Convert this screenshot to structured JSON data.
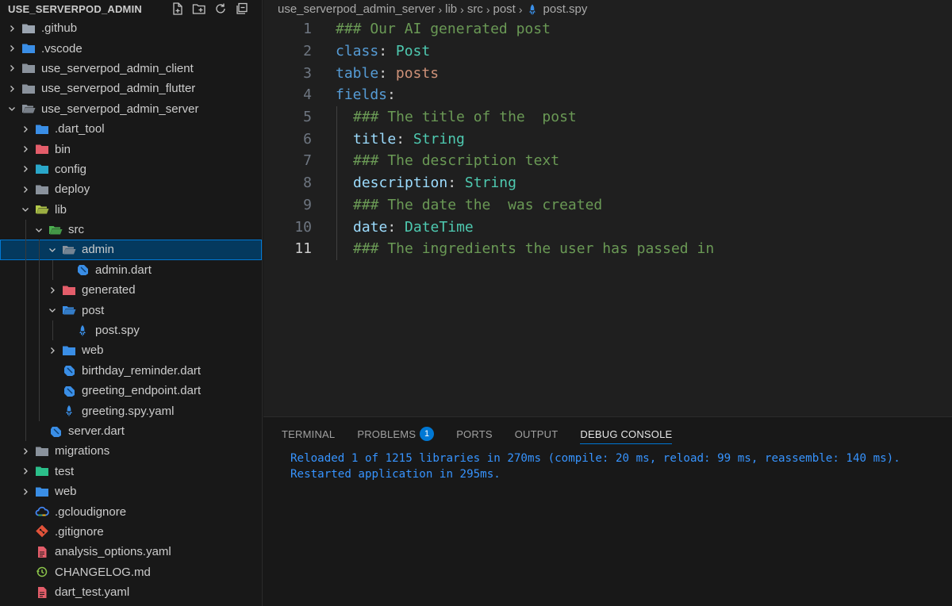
{
  "explorer": {
    "title": "USE_SERVERPOD_ADMIN",
    "actions": [
      "new-file-icon",
      "new-folder-icon",
      "refresh-icon",
      "collapse-all-icon"
    ],
    "tree": [
      {
        "label": ".github",
        "depth": 0,
        "kind": "folder",
        "state": "collapsed",
        "icon": "github-folder-icon",
        "color": "#9aa4b0"
      },
      {
        "label": ".vscode",
        "depth": 0,
        "kind": "folder",
        "state": "collapsed",
        "icon": "vscode-folder-icon",
        "color": "#3a8ee6"
      },
      {
        "label": "use_serverpod_admin_client",
        "depth": 0,
        "kind": "folder",
        "state": "collapsed",
        "icon": "folder-icon",
        "color": "#8a929c"
      },
      {
        "label": "use_serverpod_admin_flutter",
        "depth": 0,
        "kind": "folder",
        "state": "collapsed",
        "icon": "folder-icon",
        "color": "#8a929c"
      },
      {
        "label": "use_serverpod_admin_server",
        "depth": 0,
        "kind": "folder",
        "state": "expanded",
        "icon": "folder-open-icon",
        "color": "#8a929c"
      },
      {
        "label": ".dart_tool",
        "depth": 1,
        "kind": "folder",
        "state": "collapsed",
        "icon": "dart-tool-folder-icon",
        "color": "#3a8ee6"
      },
      {
        "label": "bin",
        "depth": 1,
        "kind": "folder",
        "state": "collapsed",
        "icon": "bin-folder-icon",
        "color": "#e35d6a"
      },
      {
        "label": "config",
        "depth": 1,
        "kind": "folder",
        "state": "collapsed",
        "icon": "config-folder-icon",
        "color": "#2aa7c9"
      },
      {
        "label": "deploy",
        "depth": 1,
        "kind": "folder",
        "state": "collapsed",
        "icon": "folder-icon",
        "color": "#8a929c"
      },
      {
        "label": "lib",
        "depth": 1,
        "kind": "folder",
        "state": "expanded",
        "icon": "lib-folder-icon",
        "color": "#b3c94a"
      },
      {
        "label": "src",
        "depth": 2,
        "kind": "folder",
        "state": "expanded",
        "icon": "src-folder-icon",
        "color": "#4caf50"
      },
      {
        "label": "admin",
        "depth": 3,
        "kind": "folder",
        "state": "expanded",
        "icon": "admin-folder-icon",
        "color": "#8a929c",
        "selected": true
      },
      {
        "label": "admin.dart",
        "depth": 4,
        "kind": "file",
        "icon": "dart-file-icon",
        "color": "#3a8ee6"
      },
      {
        "label": "generated",
        "depth": 3,
        "kind": "folder",
        "state": "collapsed",
        "icon": "generated-folder-icon",
        "color": "#e35d6a"
      },
      {
        "label": "post",
        "depth": 3,
        "kind": "folder",
        "state": "expanded",
        "icon": "post-folder-icon",
        "color": "#3a8ee6"
      },
      {
        "label": "post.spy",
        "depth": 4,
        "kind": "file",
        "icon": "serverpod-file-icon",
        "color": "#3a8ee6"
      },
      {
        "label": "web",
        "depth": 3,
        "kind": "folder",
        "state": "collapsed",
        "icon": "web-folder-icon",
        "color": "#3a8ee6"
      },
      {
        "label": "birthday_reminder.dart",
        "depth": 3,
        "kind": "file",
        "icon": "dart-file-icon",
        "color": "#3a8ee6"
      },
      {
        "label": "greeting_endpoint.dart",
        "depth": 3,
        "kind": "file",
        "icon": "dart-file-icon",
        "color": "#3a8ee6"
      },
      {
        "label": "greeting.spy.yaml",
        "depth": 3,
        "kind": "file",
        "icon": "serverpod-file-icon",
        "color": "#3a8ee6"
      },
      {
        "label": "server.dart",
        "depth": 2,
        "kind": "file",
        "icon": "dart-file-icon",
        "color": "#3a8ee6"
      },
      {
        "label": "migrations",
        "depth": 1,
        "kind": "folder",
        "state": "collapsed",
        "icon": "folder-icon",
        "color": "#8a929c"
      },
      {
        "label": "test",
        "depth": 1,
        "kind": "folder",
        "state": "collapsed",
        "icon": "test-folder-icon",
        "color": "#2bbf8a"
      },
      {
        "label": "web",
        "depth": 1,
        "kind": "folder",
        "state": "collapsed",
        "icon": "web-folder-icon",
        "color": "#3a8ee6"
      },
      {
        "label": ".gcloudignore",
        "depth": 1,
        "kind": "file",
        "icon": "gcloud-icon",
        "color": "#4285f4"
      },
      {
        "label": ".gitignore",
        "depth": 1,
        "kind": "file",
        "icon": "git-icon",
        "color": "#e2533a"
      },
      {
        "label": "analysis_options.yaml",
        "depth": 1,
        "kind": "file",
        "icon": "yaml-file-icon",
        "color": "#e35d6a"
      },
      {
        "label": "CHANGELOG.md",
        "depth": 1,
        "kind": "file",
        "icon": "changelog-icon",
        "color": "#8bc34a"
      },
      {
        "label": "dart_test.yaml",
        "depth": 1,
        "kind": "file",
        "icon": "yaml-file-icon",
        "color": "#e35d6a"
      }
    ]
  },
  "breadcrumb": {
    "items": [
      "use_serverpod_admin_server",
      "lib",
      "src",
      "post"
    ],
    "file": "post.spy",
    "file_icon": "serverpod-file-icon"
  },
  "editor": {
    "active_line": 11,
    "lines": [
      {
        "n": "1",
        "indent": false,
        "tokens": [
          {
            "t": "### Our AI generated post",
            "c": "comment"
          }
        ]
      },
      {
        "n": "2",
        "indent": false,
        "tokens": [
          {
            "t": "class",
            "c": "key-dim"
          },
          {
            "t": ": ",
            "c": "punct"
          },
          {
            "t": "Post",
            "c": "class"
          }
        ]
      },
      {
        "n": "3",
        "indent": false,
        "tokens": [
          {
            "t": "table",
            "c": "key-dim"
          },
          {
            "t": ": ",
            "c": "punct"
          },
          {
            "t": "posts",
            "c": "str"
          }
        ]
      },
      {
        "n": "4",
        "indent": false,
        "tokens": [
          {
            "t": "fields",
            "c": "key-dim"
          },
          {
            "t": ":",
            "c": "punct"
          }
        ]
      },
      {
        "n": "5",
        "indent": true,
        "tokens": [
          {
            "t": "### The title of the  post",
            "c": "comment"
          }
        ]
      },
      {
        "n": "6",
        "indent": true,
        "tokens": [
          {
            "t": "title",
            "c": "key"
          },
          {
            "t": ": ",
            "c": "punct"
          },
          {
            "t": "String",
            "c": "class"
          }
        ]
      },
      {
        "n": "7",
        "indent": true,
        "tokens": [
          {
            "t": "### The description text",
            "c": "comment"
          }
        ]
      },
      {
        "n": "8",
        "indent": true,
        "tokens": [
          {
            "t": "description",
            "c": "key"
          },
          {
            "t": ": ",
            "c": "punct"
          },
          {
            "t": "String",
            "c": "class"
          }
        ]
      },
      {
        "n": "9",
        "indent": true,
        "tokens": [
          {
            "t": "### The date the  was created",
            "c": "comment"
          }
        ]
      },
      {
        "n": "10",
        "indent": true,
        "tokens": [
          {
            "t": "date",
            "c": "key"
          },
          {
            "t": ": ",
            "c": "punct"
          },
          {
            "t": "DateTime",
            "c": "class"
          }
        ]
      },
      {
        "n": "11",
        "indent": true,
        "tokens": [
          {
            "t": "### The ingredients the user has passed in",
            "c": "comment"
          }
        ]
      }
    ]
  },
  "panel": {
    "tabs": [
      {
        "label": "TERMINAL",
        "active": false
      },
      {
        "label": "PROBLEMS",
        "active": false,
        "badge": "1"
      },
      {
        "label": "PORTS",
        "active": false
      },
      {
        "label": "OUTPUT",
        "active": false
      },
      {
        "label": "DEBUG CONSOLE",
        "active": true
      }
    ],
    "console": [
      "Reloaded 1 of 1215 libraries in 270ms (compile: 20 ms, reload: 99 ms, reassemble: 140 ms).",
      "Restarted application in 295ms."
    ]
  }
}
